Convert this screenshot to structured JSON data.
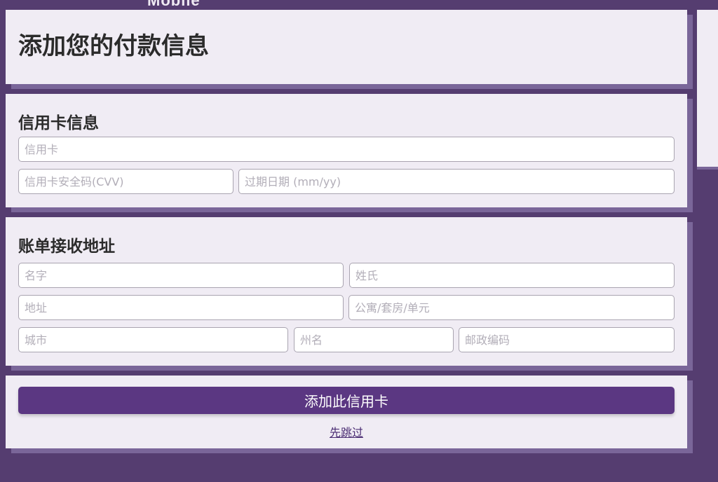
{
  "header": {
    "partial_text": "Mobile"
  },
  "page": {
    "title": "添加您的付款信息"
  },
  "credit_card": {
    "section_title": "信用卡信息",
    "card_number_placeholder": "信用卡",
    "cvv_placeholder": "信用卡安全码(CVV)",
    "expiry_placeholder": "过期日期 (mm/yy)"
  },
  "billing": {
    "section_title": "账单接收地址",
    "first_name_placeholder": "名字",
    "last_name_placeholder": "姓氏",
    "address_placeholder": "地址",
    "apt_placeholder": "公寓/套房/单元",
    "city_placeholder": "城市",
    "state_placeholder": "州名",
    "zip_placeholder": "邮政编码"
  },
  "actions": {
    "add_card_label": "添加此信用卡",
    "skip_label": "先跳过"
  },
  "colors": {
    "background": "#553d70",
    "card": "#f0ecf4",
    "primary_button": "#5b3782"
  }
}
